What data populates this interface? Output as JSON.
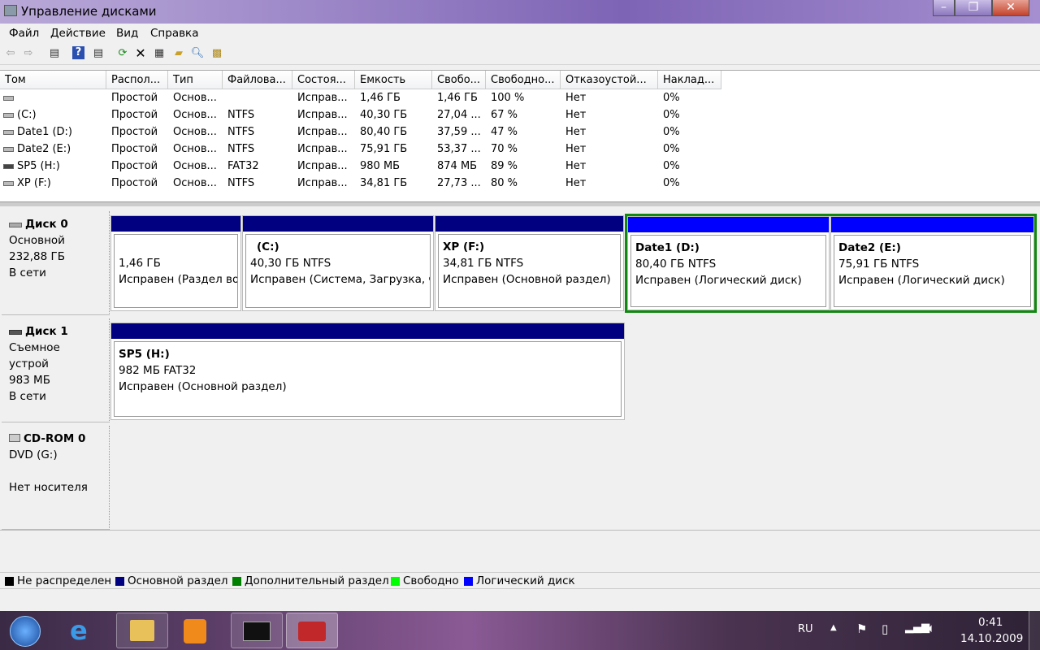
{
  "window": {
    "title": "Управление дисками",
    "minimize": "–",
    "maximize": "❐",
    "close": "✕"
  },
  "menu": [
    "Файл",
    "Действие",
    "Вид",
    "Справка"
  ],
  "toolbar_icons": [
    "back-icon",
    "forward-icon",
    "console-tree-icon",
    "help-icon",
    "action-pane-icon",
    "refresh-icon",
    "delete-icon",
    "properties-icon",
    "open-icon",
    "explore-icon",
    "settings-icon"
  ],
  "table": {
    "columns": [
      "Том",
      "Распол...",
      "Тип",
      "Файлова...",
      "Состоя...",
      "Емкость",
      "Свобо...",
      "Свободно...",
      "Отказоустой...",
      "Наклад..."
    ],
    "rows": [
      [
        "",
        "Простой",
        "Основ...",
        "",
        "Исправ...",
        "1,46 ГБ",
        "1,46 ГБ",
        "100 %",
        "Нет",
        "0%"
      ],
      [
        "(C:)",
        "Простой",
        "Основ...",
        "NTFS",
        "Исправ...",
        "40,30 ГБ",
        "27,04 ...",
        "67 %",
        "Нет",
        "0%"
      ],
      [
        "Date1 (D:)",
        "Простой",
        "Основ...",
        "NTFS",
        "Исправ...",
        "80,40 ГБ",
        "37,59 ...",
        "47 %",
        "Нет",
        "0%"
      ],
      [
        "Date2 (E:)",
        "Простой",
        "Основ...",
        "NTFS",
        "Исправ...",
        "75,91 ГБ",
        "53,37 ...",
        "70 %",
        "Нет",
        "0%"
      ],
      [
        "SP5 (H:)",
        "Простой",
        "Основ...",
        "FAT32",
        "Исправ...",
        "980 МБ",
        "874 МБ",
        "89 %",
        "Нет",
        "0%"
      ],
      [
        "XP (F:)",
        "Простой",
        "Основ...",
        "NTFS",
        "Исправ...",
        "34,81 ГБ",
        "27,73 ...",
        "80 %",
        "Нет",
        "0%"
      ]
    ]
  },
  "disks": [
    {
      "name": "Диск 0",
      "type": "Основной",
      "size": "232,88 ГБ",
      "status": "В сети",
      "partitions": [
        {
          "name": "",
          "size": "1,46 ГБ",
          "status": "Исправен (Раздел во"
        },
        {
          "name": "(C:)",
          "size": "40,30 ГБ NTFS",
          "status": "Исправен (Система, Загрузка, Ф"
        },
        {
          "name": "XP  (F:)",
          "size": "34,81 ГБ NTFS",
          "status": "Исправен (Основной раздел)"
        },
        {
          "name": "Date1  (D:)",
          "size": "80,40 ГБ NTFS",
          "status": "Исправен (Логический диск)"
        },
        {
          "name": "Date2  (E:)",
          "size": "75,91 ГБ NTFS",
          "status": "Исправен (Логический диск)"
        }
      ]
    },
    {
      "name": "Диск 1",
      "type": "Съемное устрой",
      "size": "983 МБ",
      "status": "В сети",
      "partitions": [
        {
          "name": "SP5  (H:)",
          "size": "982 МБ FAT32",
          "status": "Исправен (Основной раздел)"
        }
      ]
    },
    {
      "name": "CD-ROM 0",
      "type": "DVD (G:)",
      "size": "",
      "status": "Нет носителя"
    }
  ],
  "legend": [
    {
      "label": "Не распределен",
      "color": "#000000"
    },
    {
      "label": "Основной раздел",
      "color": "#000080"
    },
    {
      "label": "Дополнительный раздел",
      "color": "#008000"
    },
    {
      "label": "Свободно",
      "color": "#00ff00"
    },
    {
      "label": "Логический диск",
      "color": "#0000ff"
    }
  ],
  "tray": {
    "lang": "RU",
    "time": "0:41",
    "date": "14.10.2009"
  }
}
